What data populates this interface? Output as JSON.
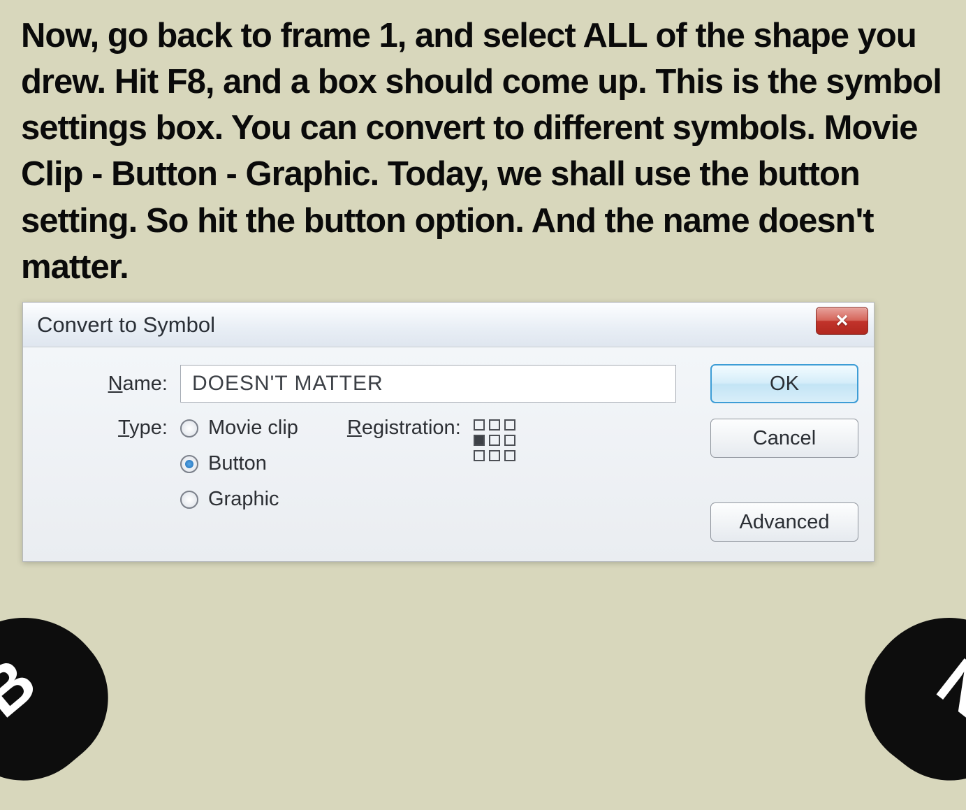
{
  "instruction": "Now, go back to frame 1, and select ALL of the shape you drew. Hit F8, and a box should come up. This is the symbol settings box. You can convert to different symbols. Movie Clip - Button - Graphic. Today, we shall use the button setting. So hit the button option. And the name doesn't matter.",
  "dialog": {
    "title": "Convert to Symbol",
    "name_label_prefix": "N",
    "name_label_rest": "ame:",
    "name_value": "DOESN'T MATTER",
    "type_label_prefix": "T",
    "type_label_rest": "ype:",
    "type_options": {
      "movie_clip": "Movie clip",
      "button": "Button",
      "graphic": "Graphic"
    },
    "registration_label_prefix": "R",
    "registration_label_rest": "egistration:",
    "buttons": {
      "ok": "OK",
      "cancel": "Cancel",
      "advanced": "Advanced"
    }
  },
  "badges": {
    "left": "B",
    "right": "N"
  }
}
